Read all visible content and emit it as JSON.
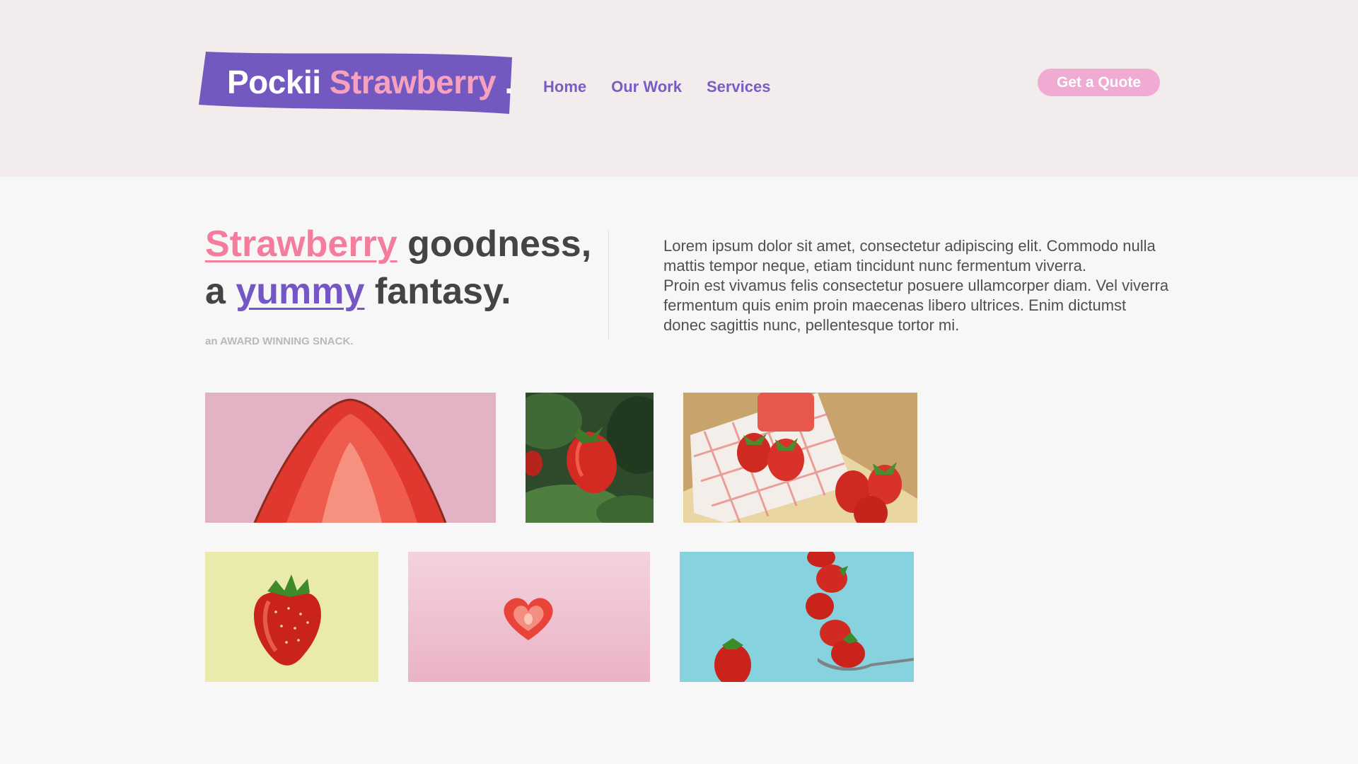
{
  "brand": {
    "name_part1": "Pockii",
    "name_part2": "Strawberry",
    "name_suffix": ".",
    "badge_color": "#7358c0",
    "accent_pink": "#f6a1bd"
  },
  "nav": {
    "items": [
      {
        "label": "Home"
      },
      {
        "label": "Our Work"
      },
      {
        "label": "Services"
      }
    ],
    "color": "#7a5cc5"
  },
  "cta": {
    "label": "Get a Quote",
    "color": "#efabd2"
  },
  "hero": {
    "headline": {
      "word1": "Strawberry",
      "rest1": " goodness,",
      "prefix2": "a ",
      "word2": "yummy",
      "rest2": " fantasy."
    },
    "tagline": "an AWARD WINNING SNACK.",
    "paragraph1": "Lorem ipsum dolor sit amet, consectetur adipiscing elit. Commodo nulla mattis tempor neque, etiam tincidunt nunc fermentum viverra.",
    "paragraph2": "Proin est vivamus felis consectetur posuere ullamcorper diam. Vel viverra fermentum quis enim proin maecenas libero ultrices. Enim dictumst donec sagittis nunc, pellentesque tortor mi."
  },
  "gallery": {
    "images": [
      {
        "subject": "strawberry-half-on-pink",
        "background": "#e3b3c5"
      },
      {
        "subject": "strawberry-on-plant",
        "background": "#2e4a2a"
      },
      {
        "subject": "strawberries-on-cloth-and-board",
        "background": "#c9a36c"
      },
      {
        "subject": "strawberry-on-yellow",
        "background": "#ebeaad"
      },
      {
        "subject": "heart-strawberry-slice-on-pink",
        "background": "#f1cbd8"
      },
      {
        "subject": "strawberries-falling-onto-spoon",
        "background": "#86d2df"
      }
    ]
  }
}
